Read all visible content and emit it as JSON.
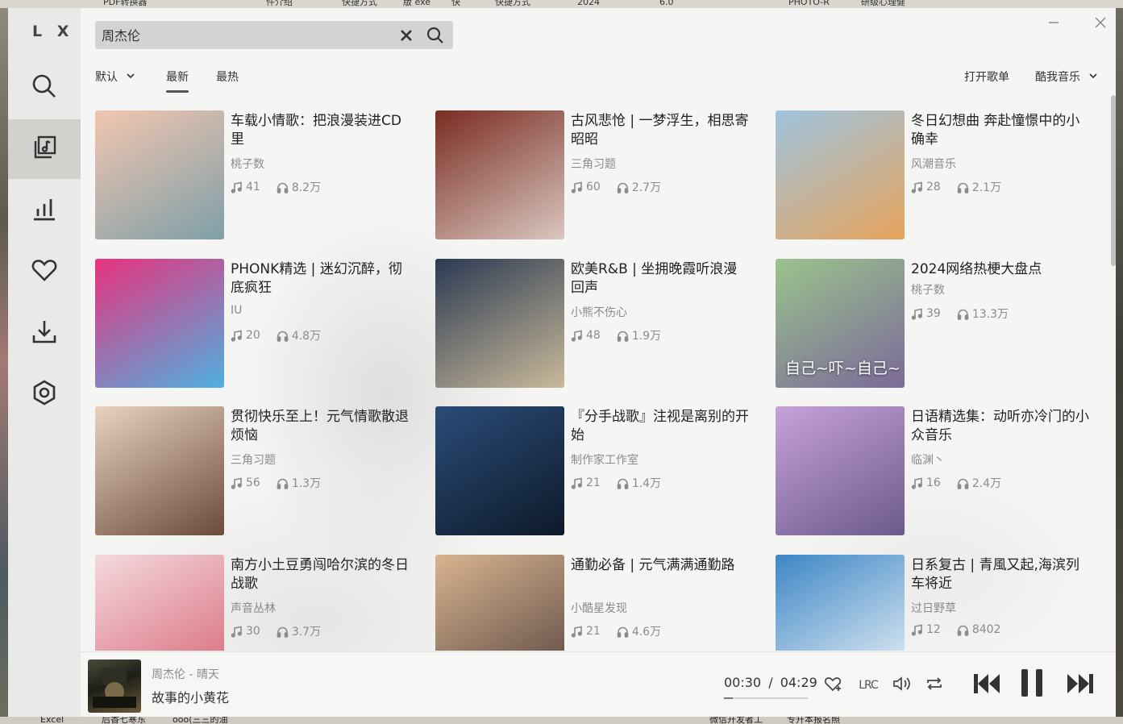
{
  "desktop": {
    "top_fragments": [
      "PDF转换器",
      "件介绍",
      "快捷方式",
      "版 exe",
      "快",
      "快捷方式",
      "2024",
      "6.0",
      "PHOTO-R",
      "研级心理健"
    ],
    "bottom_fragments": [
      "Excel",
      "后香七寒东",
      "ooo(三三的油",
      "微信开发者工",
      "专升本报名照"
    ]
  },
  "app": {
    "logo": "L X"
  },
  "sidebar": {
    "items": [
      {
        "name": "search",
        "icon": "search-icon"
      },
      {
        "name": "songlist",
        "icon": "music-list-icon",
        "active": true
      },
      {
        "name": "leaderboard",
        "icon": "bar-chart-icon"
      },
      {
        "name": "favorites",
        "icon": "heart-icon"
      },
      {
        "name": "download",
        "icon": "download-icon"
      },
      {
        "name": "settings",
        "icon": "gear-icon"
      }
    ]
  },
  "search": {
    "value": "周杰伦"
  },
  "filters": {
    "sort_label": "默认",
    "tabs": [
      {
        "label": "最新",
        "active": true
      },
      {
        "label": "最热",
        "active": false
      }
    ],
    "open_playlist": "打开歌单",
    "source_label": "酷我音乐"
  },
  "playlists": [
    {
      "title": "车载小情歌：把浪漫装进CD里",
      "author": "桃子数",
      "songs": "41",
      "plays": "8.2万",
      "colors": [
        "#f2c6b0",
        "#7f9fa8"
      ]
    },
    {
      "title": "古风悲怆 | 一梦浮生，相思寄昭昭",
      "author": "三角习题",
      "songs": "60",
      "plays": "2.7万",
      "colors": [
        "#7a2c22",
        "#d9c7bf"
      ]
    },
    {
      "title": "冬日幻想曲 奔赴憧憬中的小确幸",
      "author": "风潮音乐",
      "songs": "28",
      "plays": "2.1万",
      "colors": [
        "#9fc4df",
        "#e6a35c"
      ]
    },
    {
      "title": "PHONK精选 | 迷幻沉醉，彻底疯狂",
      "author": "IU",
      "songs": "20",
      "plays": "4.8万",
      "colors": [
        "#e8327e",
        "#4fb0e0"
      ]
    },
    {
      "title": "欧美R&B | 坐拥晚霞听浪漫回声",
      "author": "小熊不伤心",
      "songs": "48",
      "plays": "1.9万",
      "colors": [
        "#2b3a52",
        "#c9b99a"
      ]
    },
    {
      "title": "2024网络热梗大盘点",
      "author": "桃子数",
      "songs": "39",
      "plays": "13.3万",
      "colors": [
        "#9ac38c",
        "#7c6a9a"
      ],
      "caption": "自己~吓~自己~"
    },
    {
      "title": "贯彻快乐至上！元气情歌散退烦恼",
      "author": "三角习题",
      "songs": "56",
      "plays": "1.3万",
      "colors": [
        "#e9d3c0",
        "#6b4b3a"
      ]
    },
    {
      "title": "『分手战歌』注视是离别的开始",
      "author": "制作家工作室",
      "songs": "21",
      "plays": "1.4万",
      "colors": [
        "#2a4c78",
        "#0e1a2a"
      ]
    },
    {
      "title": "日语精选集：动听亦冷门的小众音乐",
      "author": "临渊丶",
      "songs": "16",
      "plays": "2.4万",
      "colors": [
        "#c7a2d8",
        "#6c5a8c"
      ]
    },
    {
      "title": "南方小土豆勇闯哈尔滨的冬日战歌",
      "author": "声音丛林",
      "songs": "30",
      "plays": "3.7万",
      "colors": [
        "#f4d9de",
        "#d86a7a"
      ]
    },
    {
      "title": "通勤必备 | 元气满满通勤路",
      "author": "小酷星发现",
      "songs": "21",
      "plays": "4.6万",
      "colors": [
        "#d9b48f",
        "#5c4a44"
      ]
    },
    {
      "title": "日系复古 | 青風又起,海滨列车将近",
      "author": "过日野草",
      "songs": "12",
      "plays": "8402",
      "colors": [
        "#3d86c6",
        "#e9f1f6"
      ]
    }
  ],
  "player": {
    "artist_line": "周杰伦 - 晴天",
    "track": "故事的小黄花",
    "current_time": "00:30",
    "separator": "/",
    "total_time": "04:29",
    "progress": 0.11,
    "lyric_label": "LRC"
  }
}
